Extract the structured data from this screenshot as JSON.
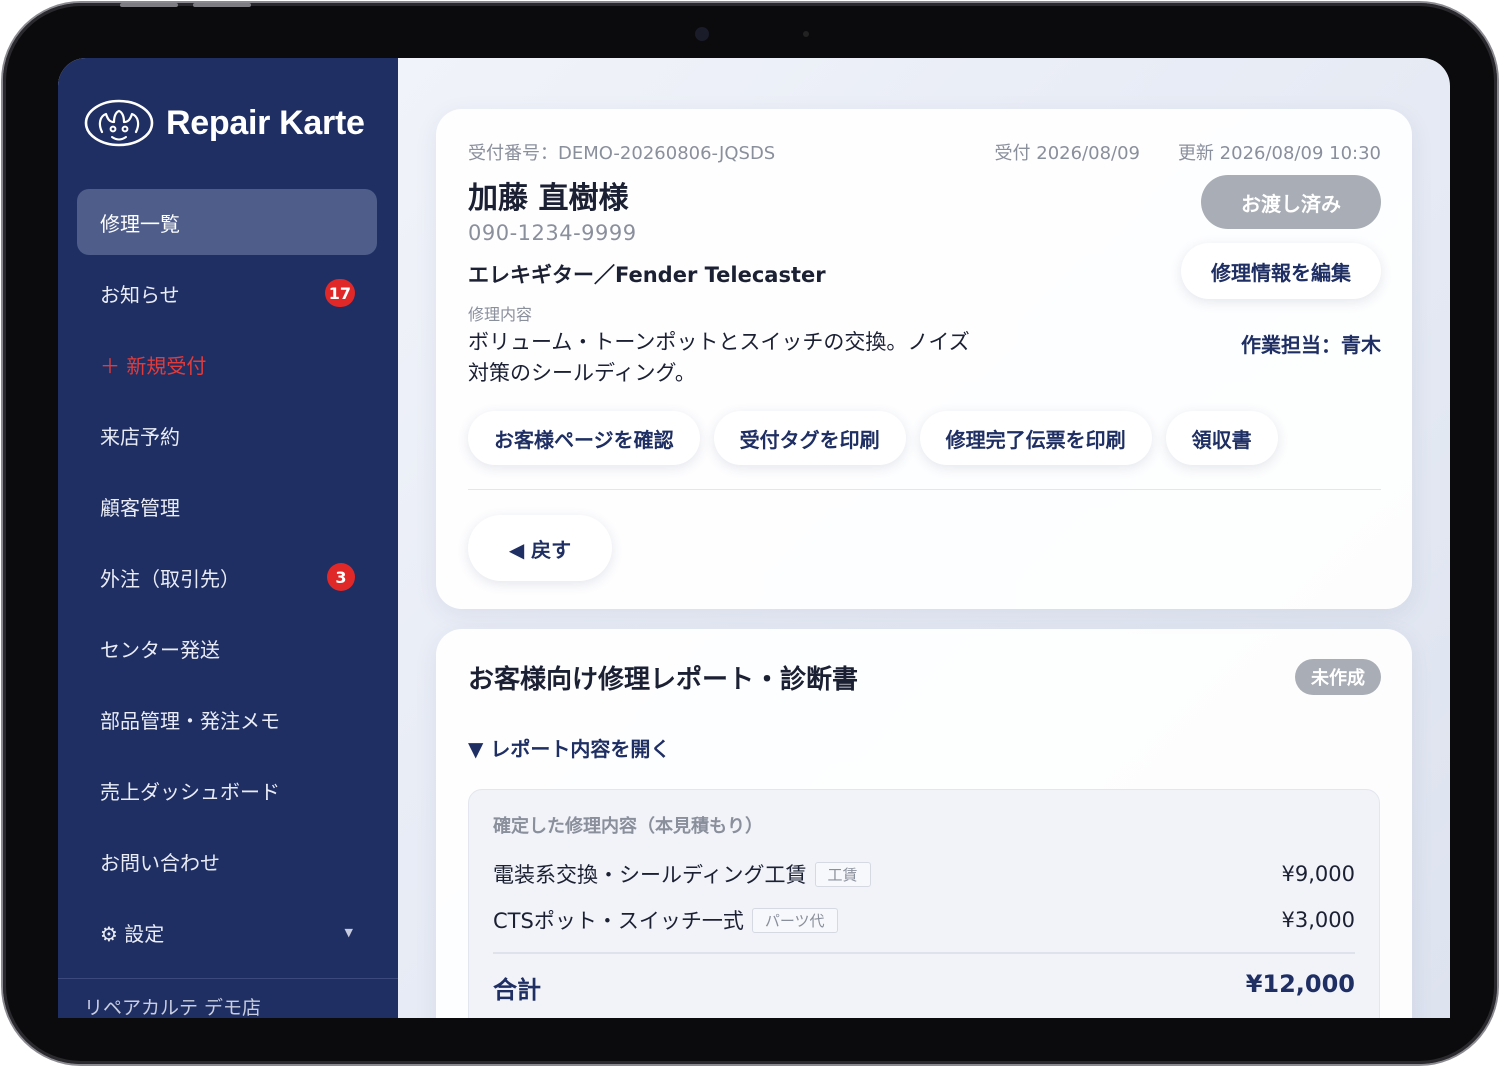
{
  "app": {
    "name": "Repair Karte"
  },
  "sidebar": {
    "items": [
      {
        "label": "修理一覧"
      },
      {
        "label": "お知らせ",
        "badge": "17"
      },
      {
        "label": "＋ 新規受付"
      },
      {
        "label": "来店予約"
      },
      {
        "label": "顧客管理"
      },
      {
        "label": "外注（取引先）",
        "badge": "3"
      },
      {
        "label": "センター発送"
      },
      {
        "label": "部品管理・発注メモ"
      },
      {
        "label": "売上ダッシュボード"
      },
      {
        "label": "お問い合わせ"
      },
      {
        "label": "⚙ 設定"
      }
    ],
    "shop_name": "リペアカルテ デモ店"
  },
  "repair": {
    "receipt_number": "受付番号：DEMO-20260806-JQSDS",
    "received": "受付 2026/08/09",
    "updated": "更新 2026/08/09 10:30",
    "customer_name": "加藤 直樹様",
    "phone": "090-1234-9999",
    "instrument": "エレキギター／Fender Telecaster",
    "content_label": "修理内容",
    "content": "ボリューム・トーンポットとスイッチの交換。ノイズ対策のシールディング。",
    "status": "お渡し済み",
    "edit_label": "修理情報を編集",
    "assignee": "作業担当：青木",
    "actions": [
      "お客様ページを確認",
      "受付タグを印刷",
      "修理完了伝票を印刷",
      "領収書"
    ],
    "back_label": "◀ 戻す"
  },
  "report": {
    "title": "お客様向け修理レポート・診断書",
    "status": "未作成",
    "open_label": "▼ レポート内容を開く",
    "estimate_heading": "確定した修理内容（本見積もり）",
    "lines": [
      {
        "name": "電装系交換・シールディング工賃",
        "tag": "工賃",
        "price": "¥9,000"
      },
      {
        "name": "CTSポット・スイッチ一式",
        "tag": "パーツ代",
        "price": "¥3,000"
      }
    ],
    "total_label": "合計",
    "total": "¥12,000"
  },
  "colors": {
    "sidebar": "#1f2f63",
    "accent": "#1f2f63",
    "badge": "#e02828",
    "new_item": "#e23b3b"
  }
}
